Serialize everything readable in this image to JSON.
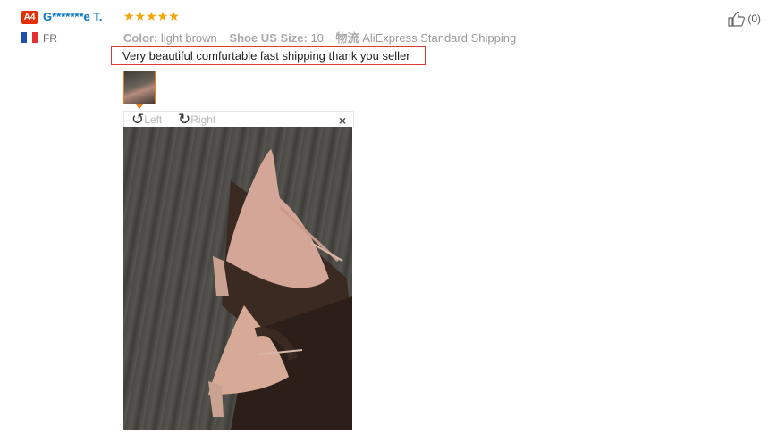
{
  "review": {
    "badge": "A4",
    "user_name": "G*******e T.",
    "country": "FR",
    "stars_glyph": "★★★★★",
    "meta": {
      "color_label": "Color:",
      "color_value": "light brown",
      "size_label": "Shoe US Size:",
      "size_value": "10",
      "shipping_label": "物流",
      "shipping_value": "AliExpress Standard Shipping"
    },
    "feedback_text": "Very beautiful comfurtable fast shipping thank you seller",
    "helpful_count": "(0)"
  },
  "viewer": {
    "rotate_left": "Left",
    "rotate_right": "Right",
    "close_glyph": "×"
  },
  "colors": {
    "accent": "#e57f1a",
    "star": "#f7a400",
    "link": "#0073c7",
    "badge": "#e62e04",
    "highlight_border": "#d93a3a"
  },
  "icons": {
    "thumbs_up": "thumbs-up-icon",
    "rotate_left": "rotate-left-icon",
    "rotate_right": "rotate-right-icon",
    "close": "close-icon",
    "flag": "france-flag-icon"
  }
}
